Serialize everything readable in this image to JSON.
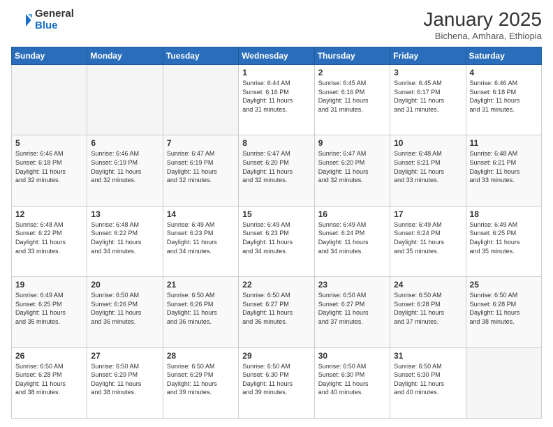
{
  "logo": {
    "general": "General",
    "blue": "Blue"
  },
  "header": {
    "month": "January 2025",
    "location": "Bichena, Amhara, Ethiopia"
  },
  "weekdays": [
    "Sunday",
    "Monday",
    "Tuesday",
    "Wednesday",
    "Thursday",
    "Friday",
    "Saturday"
  ],
  "weeks": [
    [
      {
        "day": "",
        "info": ""
      },
      {
        "day": "",
        "info": ""
      },
      {
        "day": "",
        "info": ""
      },
      {
        "day": "1",
        "info": "Sunrise: 6:44 AM\nSunset: 6:16 PM\nDaylight: 11 hours\nand 31 minutes."
      },
      {
        "day": "2",
        "info": "Sunrise: 6:45 AM\nSunset: 6:16 PM\nDaylight: 11 hours\nand 31 minutes."
      },
      {
        "day": "3",
        "info": "Sunrise: 6:45 AM\nSunset: 6:17 PM\nDaylight: 11 hours\nand 31 minutes."
      },
      {
        "day": "4",
        "info": "Sunrise: 6:46 AM\nSunset: 6:18 PM\nDaylight: 11 hours\nand 31 minutes."
      }
    ],
    [
      {
        "day": "5",
        "info": "Sunrise: 6:46 AM\nSunset: 6:18 PM\nDaylight: 11 hours\nand 32 minutes."
      },
      {
        "day": "6",
        "info": "Sunrise: 6:46 AM\nSunset: 6:19 PM\nDaylight: 11 hours\nand 32 minutes."
      },
      {
        "day": "7",
        "info": "Sunrise: 6:47 AM\nSunset: 6:19 PM\nDaylight: 11 hours\nand 32 minutes."
      },
      {
        "day": "8",
        "info": "Sunrise: 6:47 AM\nSunset: 6:20 PM\nDaylight: 11 hours\nand 32 minutes."
      },
      {
        "day": "9",
        "info": "Sunrise: 6:47 AM\nSunset: 6:20 PM\nDaylight: 11 hours\nand 32 minutes."
      },
      {
        "day": "10",
        "info": "Sunrise: 6:48 AM\nSunset: 6:21 PM\nDaylight: 11 hours\nand 33 minutes."
      },
      {
        "day": "11",
        "info": "Sunrise: 6:48 AM\nSunset: 6:21 PM\nDaylight: 11 hours\nand 33 minutes."
      }
    ],
    [
      {
        "day": "12",
        "info": "Sunrise: 6:48 AM\nSunset: 6:22 PM\nDaylight: 11 hours\nand 33 minutes."
      },
      {
        "day": "13",
        "info": "Sunrise: 6:48 AM\nSunset: 6:22 PM\nDaylight: 11 hours\nand 34 minutes."
      },
      {
        "day": "14",
        "info": "Sunrise: 6:49 AM\nSunset: 6:23 PM\nDaylight: 11 hours\nand 34 minutes."
      },
      {
        "day": "15",
        "info": "Sunrise: 6:49 AM\nSunset: 6:23 PM\nDaylight: 11 hours\nand 34 minutes."
      },
      {
        "day": "16",
        "info": "Sunrise: 6:49 AM\nSunset: 6:24 PM\nDaylight: 11 hours\nand 34 minutes."
      },
      {
        "day": "17",
        "info": "Sunrise: 6:49 AM\nSunset: 6:24 PM\nDaylight: 11 hours\nand 35 minutes."
      },
      {
        "day": "18",
        "info": "Sunrise: 6:49 AM\nSunset: 6:25 PM\nDaylight: 11 hours\nand 35 minutes."
      }
    ],
    [
      {
        "day": "19",
        "info": "Sunrise: 6:49 AM\nSunset: 6:25 PM\nDaylight: 11 hours\nand 35 minutes."
      },
      {
        "day": "20",
        "info": "Sunrise: 6:50 AM\nSunset: 6:26 PM\nDaylight: 11 hours\nand 36 minutes."
      },
      {
        "day": "21",
        "info": "Sunrise: 6:50 AM\nSunset: 6:26 PM\nDaylight: 11 hours\nand 36 minutes."
      },
      {
        "day": "22",
        "info": "Sunrise: 6:50 AM\nSunset: 6:27 PM\nDaylight: 11 hours\nand 36 minutes."
      },
      {
        "day": "23",
        "info": "Sunrise: 6:50 AM\nSunset: 6:27 PM\nDaylight: 11 hours\nand 37 minutes."
      },
      {
        "day": "24",
        "info": "Sunrise: 6:50 AM\nSunset: 6:28 PM\nDaylight: 11 hours\nand 37 minutes."
      },
      {
        "day": "25",
        "info": "Sunrise: 6:50 AM\nSunset: 6:28 PM\nDaylight: 11 hours\nand 38 minutes."
      }
    ],
    [
      {
        "day": "26",
        "info": "Sunrise: 6:50 AM\nSunset: 6:28 PM\nDaylight: 11 hours\nand 38 minutes."
      },
      {
        "day": "27",
        "info": "Sunrise: 6:50 AM\nSunset: 6:29 PM\nDaylight: 11 hours\nand 38 minutes."
      },
      {
        "day": "28",
        "info": "Sunrise: 6:50 AM\nSunset: 6:29 PM\nDaylight: 11 hours\nand 39 minutes."
      },
      {
        "day": "29",
        "info": "Sunrise: 6:50 AM\nSunset: 6:30 PM\nDaylight: 11 hours\nand 39 minutes."
      },
      {
        "day": "30",
        "info": "Sunrise: 6:50 AM\nSunset: 6:30 PM\nDaylight: 11 hours\nand 40 minutes."
      },
      {
        "day": "31",
        "info": "Sunrise: 6:50 AM\nSunset: 6:30 PM\nDaylight: 11 hours\nand 40 minutes."
      },
      {
        "day": "",
        "info": ""
      }
    ]
  ]
}
